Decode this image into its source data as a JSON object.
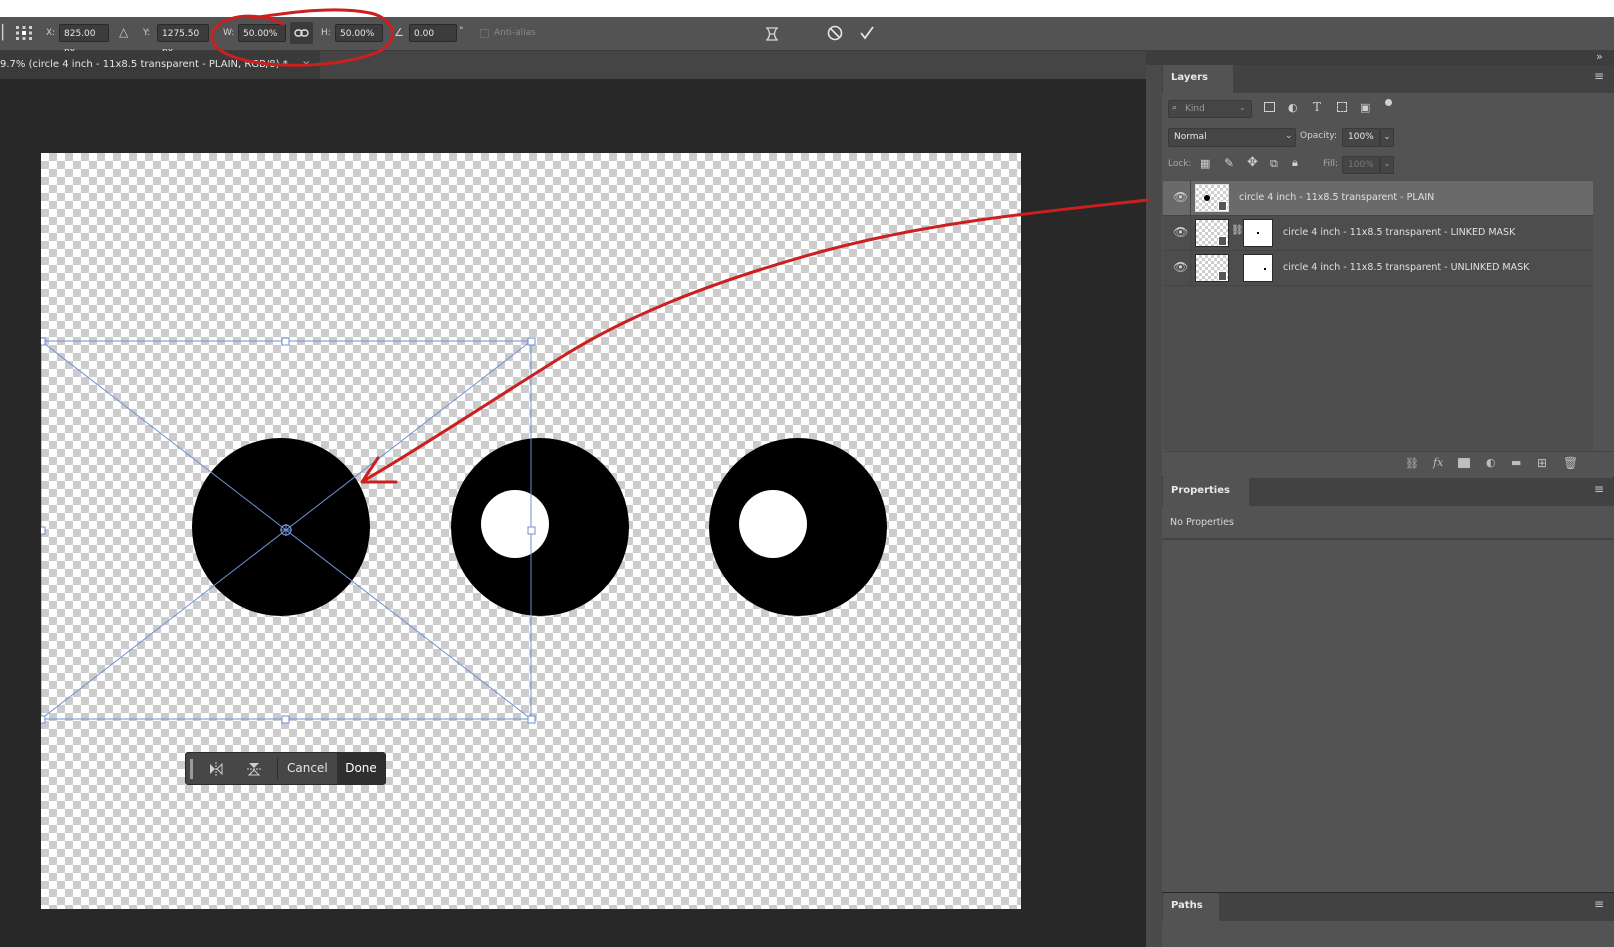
{
  "options_bar": {
    "x_label": "X:",
    "x_value": "825.00 px",
    "y_label": "Y:",
    "y_value": "1275.50 px",
    "w_label": "W:",
    "w_value": "50.00%",
    "h_label": "H:",
    "h_value": "50.00%",
    "angle_value": "0.00",
    "degree_symbol": "°",
    "antialias_label": "Anti-alias"
  },
  "document_tab": {
    "title": "9.7% (circle 4 inch - 11x8.5 transparent - PLAIN, RGB/8) *",
    "close": "×"
  },
  "layers_panel": {
    "tab_label": "Layers",
    "search_placeholder": "Kind",
    "blend_mode": "Normal",
    "opacity_label": "Opacity:",
    "opacity_value": "100%",
    "lock_label": "Lock:",
    "fill_label": "Fill:",
    "fill_value": "100%",
    "layers": [
      {
        "name": "circle 4 inch - 11x8.5 transparent - PLAIN",
        "selected": true,
        "has_mask": false
      },
      {
        "name": "circle 4 inch - 11x8.5 transparent - LINKED MASK",
        "selected": false,
        "has_mask": true
      },
      {
        "name": "circle 4 inch - 11x8.5 transparent - UNLINKED MASK",
        "selected": false,
        "has_mask": true
      }
    ]
  },
  "properties_panel": {
    "tab_label": "Properties",
    "empty_text": "No Properties"
  },
  "paths_panel": {
    "tab_label": "Paths"
  },
  "transform_bar": {
    "cancel_label": "Cancel",
    "done_label": "Done"
  },
  "colors": {
    "annotation_red": "#cc1f1f",
    "transform_blue": "#6f8fd6",
    "panel_bg": "#535353",
    "workspace_bg": "#282828"
  }
}
